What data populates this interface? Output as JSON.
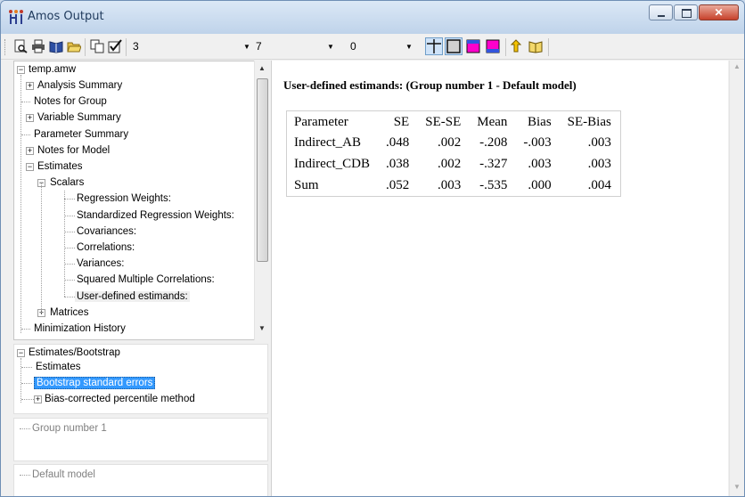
{
  "window": {
    "title": "Amos Output",
    "icon": "amos-app-icon",
    "controls": [
      "minimize-icon",
      "maximize-icon",
      "close-icon"
    ]
  },
  "toolbar": {
    "decimals_value": "3",
    "columns_value": "7",
    "table_value": "0",
    "icons": [
      "print-preview-icon",
      "print-icon",
      "book-icon",
      "open-folder-icon",
      "copy-icon",
      "checkmark-icon",
      "table-rules-icon",
      "table-frame-icon",
      "color-heading-icon",
      "color-fill-icon",
      "up-level-icon",
      "help-book-icon"
    ]
  },
  "tree": {
    "root": "temp.amw",
    "items": [
      {
        "label": "Analysis Summary",
        "level": 1,
        "expander": "+"
      },
      {
        "label": "Notes for Group",
        "level": 1,
        "expander": ""
      },
      {
        "label": "Variable Summary",
        "level": 1,
        "expander": "+"
      },
      {
        "label": "Parameter Summary",
        "level": 1,
        "expander": ""
      },
      {
        "label": "Notes for Model",
        "level": 1,
        "expander": "+"
      },
      {
        "label": "Estimates",
        "level": 1,
        "expander": "-"
      },
      {
        "label": "Scalars",
        "level": 2,
        "expander": "-"
      },
      {
        "label": "Regression Weights:",
        "level": 3,
        "expander": ""
      },
      {
        "label": "Standardized Regression Weights:",
        "level": 3,
        "expander": ""
      },
      {
        "label": "Covariances:",
        "level": 3,
        "expander": ""
      },
      {
        "label": "Correlations:",
        "level": 3,
        "expander": ""
      },
      {
        "label": "Variances:",
        "level": 3,
        "expander": ""
      },
      {
        "label": "Squared Multiple Correlations:",
        "level": 3,
        "expander": ""
      },
      {
        "label": "User-defined estimands:",
        "level": 3,
        "expander": ""
      },
      {
        "label": "Matrices",
        "level": 2,
        "expander": "+"
      },
      {
        "label": "Minimization History",
        "level": 1,
        "expander": ""
      }
    ]
  },
  "bootstrap_tree": {
    "root": "Estimates/Bootstrap",
    "items": [
      {
        "label": "Estimates"
      },
      {
        "label": "Bootstrap standard errors"
      },
      {
        "label": "Bias-corrected percentile method"
      }
    ]
  },
  "groups": {
    "item": "Group number 1"
  },
  "models": {
    "item": "Default model"
  },
  "content": {
    "title": "User-defined estimands: (Group number 1 - Default model)",
    "headers": [
      "Parameter",
      "SE",
      "SE-SE",
      "Mean",
      "Bias",
      "SE-Bias"
    ],
    "rows": [
      [
        "Indirect_AB",
        ".048",
        ".002",
        "-.208",
        "-.003",
        ".003"
      ],
      [
        "Indirect_CDB",
        ".038",
        ".002",
        "-.327",
        ".003",
        ".003"
      ],
      [
        "Sum",
        ".052",
        ".003",
        "-.535",
        ".000",
        ".004"
      ]
    ]
  }
}
